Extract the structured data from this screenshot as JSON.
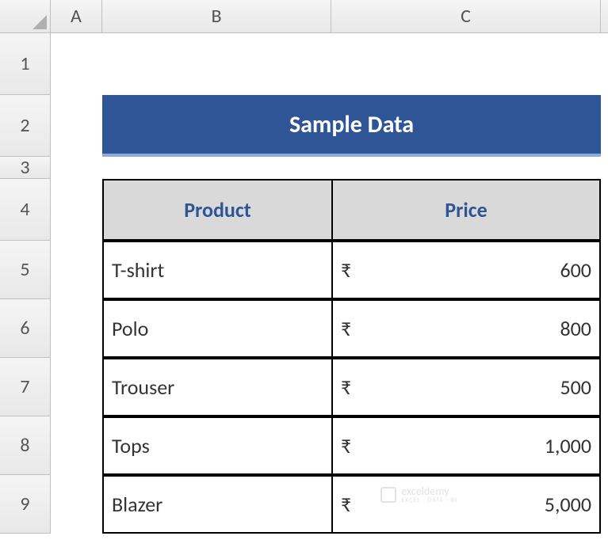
{
  "columns": [
    "A",
    "B",
    "C"
  ],
  "rows": [
    "1",
    "2",
    "3",
    "4",
    "5",
    "6",
    "7",
    "8",
    "9"
  ],
  "title": "Sample Data",
  "table": {
    "headers": {
      "product": "Product",
      "price": "Price"
    },
    "currency_symbol": "₹",
    "data": [
      {
        "product": "T-shirt",
        "price": "600"
      },
      {
        "product": "Polo",
        "price": "800"
      },
      {
        "product": "Trouser",
        "price": "500"
      },
      {
        "product": "Tops",
        "price": "1,000"
      },
      {
        "product": "Blazer",
        "price": "5,000"
      }
    ]
  },
  "watermark": {
    "main": "exceldemy",
    "sub": "EXCEL · DATA · BI"
  },
  "chart_data": {
    "type": "table",
    "title": "Sample Data",
    "columns": [
      "Product",
      "Price"
    ],
    "rows": [
      [
        "T-shirt",
        600
      ],
      [
        "Polo",
        800
      ],
      [
        "Trouser",
        500
      ],
      [
        "Tops",
        1000
      ],
      [
        "Blazer",
        5000
      ]
    ],
    "currency": "INR"
  }
}
